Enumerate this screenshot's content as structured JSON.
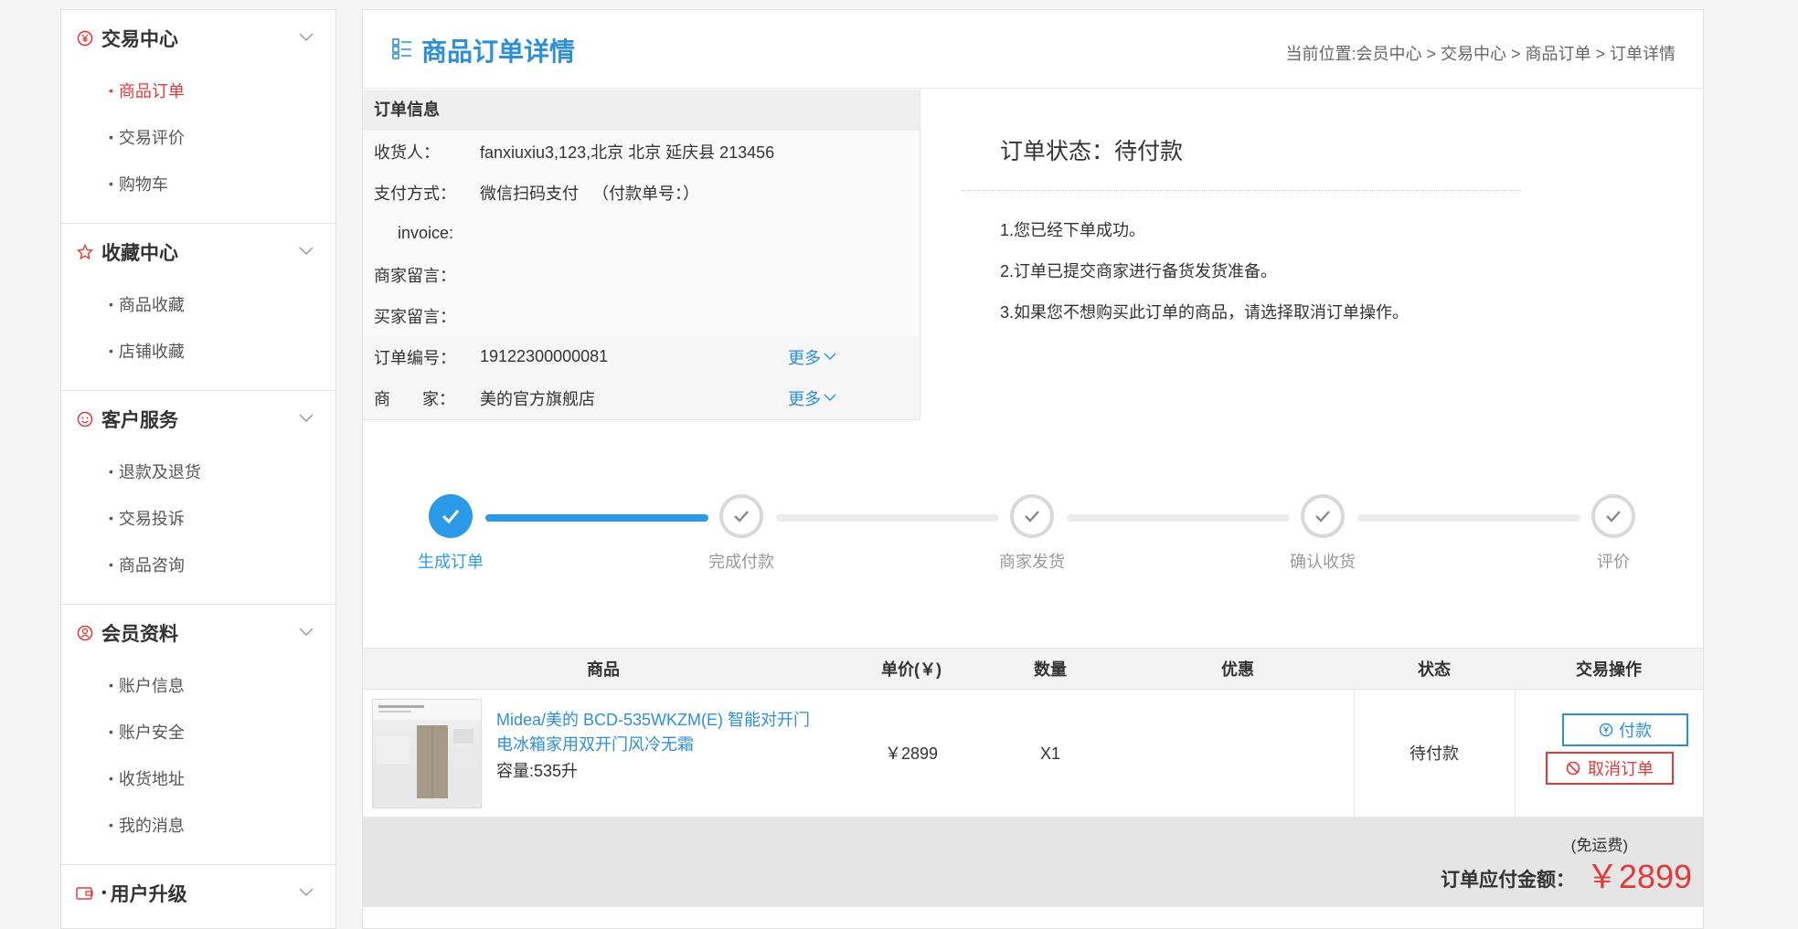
{
  "sidebar": {
    "groups": [
      {
        "title": "交易中心",
        "items": [
          "商品订单",
          "交易评价",
          "购物车"
        ]
      },
      {
        "title": "收藏中心",
        "items": [
          "商品收藏",
          "店铺收藏"
        ]
      },
      {
        "title": "客户服务",
        "items": [
          "退款及退货",
          "交易投诉",
          "商品咨询"
        ]
      },
      {
        "title": "会员资料",
        "items": [
          "账户信息",
          "账户安全",
          "收货地址",
          "我的消息"
        ]
      },
      {
        "title": "用户升级",
        "items": []
      }
    ],
    "bullet": "•"
  },
  "header": {
    "title": "商品订单详情",
    "breadcrumb": "当前位置:会员中心 > 交易中心 > 商品订单 > 订单详情"
  },
  "order_info": {
    "title": "订单信息",
    "consignee_label": "收货人：",
    "consignee_value": "fanxiuxiu3,123,北京  北京 延庆县 213456",
    "payment_label": "支付方式：",
    "payment_value": "微信扫码支付   （付款单号：）",
    "invoice_label": "invoice:",
    "seller_msg_label": "商家留言：",
    "buyer_msg_label": "买家留言：",
    "order_no_label": "订单编号：",
    "order_no_value": "19122300000081",
    "merchant_label": "商       家：",
    "merchant_value": "美的官方旗舰店",
    "more_label": "更多"
  },
  "status": {
    "title": "订单状态：待付款",
    "messages": [
      "1.您已经下单成功。",
      "2.订单已提交商家进行备货发货准备。",
      "3.如果您不想购买此订单的商品，请选择取消订单操作。"
    ]
  },
  "progress": {
    "steps": [
      "生成订单",
      "完成付款",
      "商家发货",
      "确认收货",
      "评价"
    ],
    "completed": 1
  },
  "table": {
    "headers": [
      "商品",
      "单价(￥)",
      "数量",
      "优惠",
      "状态",
      "交易操作"
    ],
    "row": {
      "product_name": "Midea/美的 BCD-535WKZM(E) 智能对开门电冰箱家用双开门风冷无霜",
      "spec": "容量:535升",
      "price": "￥2899",
      "qty": "X1",
      "discount": "",
      "status": "待付款",
      "pay_label": "付款",
      "cancel_label": "取消订单"
    }
  },
  "total": {
    "freight": "(免运费)",
    "label": "订单应付金额：",
    "amount": "￥2899"
  },
  "colors": {
    "accent": "#2e8fd6",
    "danger": "#e23a3a",
    "progress": "#2b9be8"
  }
}
